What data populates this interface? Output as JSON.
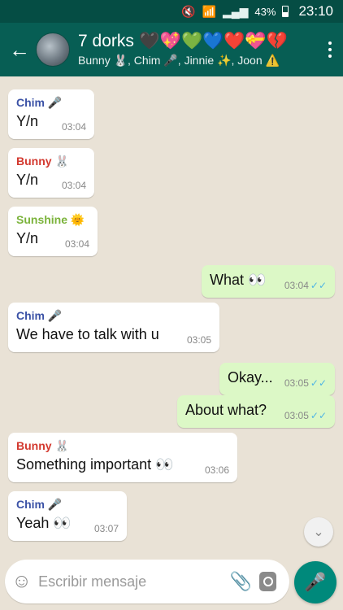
{
  "status": {
    "battery": "43%",
    "time": "23:10",
    "icons": [
      "mute-icon",
      "wifi-icon",
      "signal-icon",
      "battery-icon"
    ]
  },
  "header": {
    "title": "7 dorks 🖤💖💚💙❤️💝💔",
    "subtitle": "Bunny 🐰, Chim 🎤, Jinnie ✨, Joon ⚠️"
  },
  "colors": {
    "header": "#075e54",
    "status_bar": "#054d44",
    "outgoing_bubble": "#dcf8c6",
    "incoming_bubble": "#ffffff",
    "read_ticks": "#4fb5e4",
    "chim": "#3b52a6",
    "bunny": "#d3392f",
    "sunshine": "#7bb33b"
  },
  "messages": [
    {
      "direction": "in",
      "sender": "Chim 🎤",
      "sender_color": "#3b52a6",
      "text": "Y/n",
      "time": "03:04"
    },
    {
      "direction": "in",
      "sender": "Bunny 🐰",
      "sender_color": "#d3392f",
      "text": "Y/n",
      "time": "03:04"
    },
    {
      "direction": "in",
      "sender": "Sunshine 🌞",
      "sender_color": "#7bb33b",
      "text": "Y/n",
      "time": "03:04"
    },
    {
      "direction": "out",
      "text": "What 👀",
      "time": "03:04",
      "ticks": "✓✓"
    },
    {
      "direction": "in",
      "sender": "Chim 🎤",
      "sender_color": "#3b52a6",
      "text": "We have to talk with u",
      "time": "03:05"
    },
    {
      "direction": "out",
      "text": "Okay...",
      "time": "03:05",
      "ticks": "✓✓"
    },
    {
      "direction": "out",
      "text": "About what?",
      "time": "03:05",
      "ticks": "✓✓"
    },
    {
      "direction": "in",
      "sender": "Bunny 🐰",
      "sender_color": "#d3392f",
      "text": "Something important 👀",
      "time": "03:06"
    },
    {
      "direction": "in",
      "sender": "Chim 🎤",
      "sender_color": "#3b52a6",
      "text": "Yeah 👀",
      "time": "03:07"
    }
  ],
  "input": {
    "placeholder": "Escribir mensaje"
  }
}
